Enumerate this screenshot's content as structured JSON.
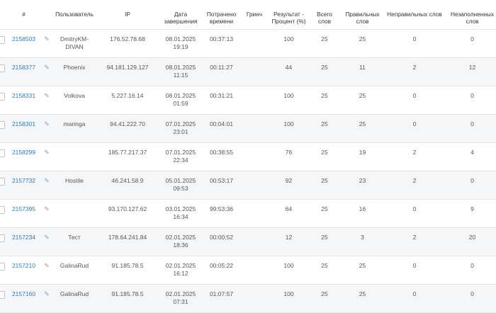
{
  "headers": {
    "id": "#",
    "user": "Пользователь",
    "ip": "IP",
    "date": "Дата завершения",
    "time": "Потрачено времени",
    "grinch": "Гринч",
    "result": "Результат - Процент (%)",
    "total": "Всего слов",
    "correct": "Правильных слов",
    "wrong": "Неправильных слов",
    "unfilled": "Незаполненных слов"
  },
  "icons": {
    "edit": "pencil-icon"
  },
  "colors": {
    "link": "#2a7bbf",
    "row_alt": "#f4f6f8"
  },
  "rows": [
    {
      "id": "2158503",
      "user": "DmitryKM-DIVAN",
      "ip": "176.52.78.68",
      "date": "08.01.2025",
      "time_of_day": "19:19",
      "spent": "00:37:13",
      "grinch": "",
      "result": "100",
      "total": "25",
      "correct": "25",
      "wrong": "0",
      "unfilled": "0"
    },
    {
      "id": "2158377",
      "user": "Phoenix",
      "ip": "94.181.129.127",
      "date": "08.01.2025",
      "time_of_day": "11:15",
      "spent": "00:11:27",
      "grinch": "",
      "result": "44",
      "total": "25",
      "correct": "11",
      "wrong": "2",
      "unfilled": "12"
    },
    {
      "id": "2158331",
      "user": "Volkova",
      "ip": "5.227.16.14",
      "date": "08.01.2025",
      "time_of_day": "01:59",
      "spent": "00:31:21",
      "grinch": "",
      "result": "100",
      "total": "25",
      "correct": "25",
      "wrong": "0",
      "unfilled": "0"
    },
    {
      "id": "2158301",
      "user": "maringa",
      "ip": "94.41.222.70",
      "date": "07.01.2025",
      "time_of_day": "23:01",
      "spent": "00:04:01",
      "grinch": "",
      "result": "100",
      "total": "25",
      "correct": "25",
      "wrong": "0",
      "unfilled": "0"
    },
    {
      "id": "2158299",
      "user": "",
      "ip": "185.77.217.37",
      "date": "07.01.2025",
      "time_of_day": "22:34",
      "spent": "00:38:55",
      "grinch": "",
      "result": "76",
      "total": "25",
      "correct": "19",
      "wrong": "2",
      "unfilled": "4"
    },
    {
      "id": "2157732",
      "user": "Hostile",
      "ip": "46.241.58.9",
      "date": "05.01.2025",
      "time_of_day": "09:53",
      "spent": "00:53:17",
      "grinch": "",
      "result": "92",
      "total": "25",
      "correct": "23",
      "wrong": "2",
      "unfilled": "0"
    },
    {
      "id": "2157395",
      "user": "",
      "ip": "93.170.127.62",
      "date": "03.01.2025",
      "time_of_day": "16:34",
      "spent": "99:53:36",
      "grinch": "",
      "result": "64",
      "total": "25",
      "correct": "16",
      "wrong": "0",
      "unfilled": "9"
    },
    {
      "id": "2157234",
      "user": "Тест",
      "ip": "178.64.241.84",
      "date": "02.01.2025",
      "time_of_day": "18:36",
      "spent": "00:00:52",
      "grinch": "",
      "result": "12",
      "total": "25",
      "correct": "3",
      "wrong": "2",
      "unfilled": "20"
    },
    {
      "id": "2157210",
      "user": "GalinaRud",
      "ip": "91.185.78.5",
      "date": "02.01.2025",
      "time_of_day": "16:12",
      "spent": "00:05:22",
      "grinch": "",
      "result": "100",
      "total": "25",
      "correct": "25",
      "wrong": "0",
      "unfilled": "0"
    },
    {
      "id": "2157160",
      "user": "GalinaRud",
      "ip": "91.185.78.5",
      "date": "02.01.2025",
      "time_of_day": "07:31",
      "spent": "01:07:57",
      "grinch": "",
      "result": "100",
      "total": "25",
      "correct": "25",
      "wrong": "0",
      "unfilled": "0"
    }
  ]
}
